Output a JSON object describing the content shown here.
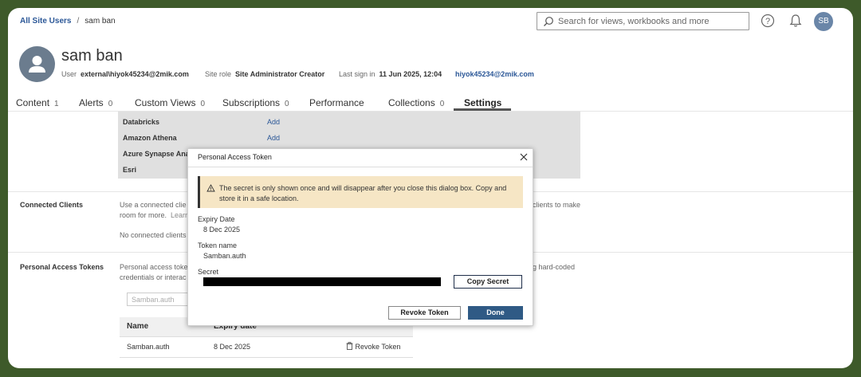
{
  "breadcrumb": {
    "parent": "All Site Users",
    "separator": "/",
    "current": "sam ban"
  },
  "search": {
    "placeholder": "Search for views, workbooks and more"
  },
  "header": {
    "avatar_initials": "SB"
  },
  "user": {
    "name": "sam ban",
    "user_label": "User",
    "user_value": "external\\hiyok45234@2mik.com",
    "role_label": "Site role",
    "role_value": "Site Administrator Creator",
    "signin_label": "Last sign in",
    "signin_value": "11 Jun 2025, 12:04",
    "email": "hiyok45234@2mik.com"
  },
  "tabs": [
    {
      "label": "Content",
      "count": "1"
    },
    {
      "label": "Alerts",
      "count": "0"
    },
    {
      "label": "Custom Views",
      "count": "0"
    },
    {
      "label": "Subscriptions",
      "count": "0"
    },
    {
      "label": "Performance",
      "count": ""
    },
    {
      "label": "Collections",
      "count": "0"
    },
    {
      "label": "Settings",
      "count": ""
    }
  ],
  "connections": {
    "rows": [
      {
        "name": "Databricks",
        "action": "Add"
      },
      {
        "name": "Amazon Athena",
        "action": "Add"
      },
      {
        "name": "Azure Synapse Ana",
        "action": ""
      },
      {
        "name": "Esri",
        "action": ""
      }
    ]
  },
  "connected_clients": {
    "label": "Connected Clients",
    "text_line1": "Use a connected clie",
    "text_line1_right": "clients to make",
    "text_line2": "room for more.",
    "text_line2_link": "Learn",
    "empty_text": "No connected clients"
  },
  "personal_access_tokens": {
    "label": "Personal Access Tokens",
    "text_line1": "Personal access toke",
    "text_line1_right": "g hard-coded",
    "text_line2": "credentials or interac",
    "filter_placeholder": "Samban.auth",
    "columns": [
      "Name",
      "Expiry date"
    ],
    "rows": [
      {
        "name": "Samban.auth",
        "expiry": "8 Dec 2025",
        "action": "Revoke Token"
      }
    ]
  },
  "dialog": {
    "title": "Personal Access Token",
    "warning": "The secret is only shown once and will disappear after you close this dialog box. Copy and store it in a safe location.",
    "expiry_label": "Expiry Date",
    "expiry_value": "8 Dec 2025",
    "token_name_label": "Token name",
    "token_name_value": "Samban.auth",
    "secret_label": "Secret",
    "copy_button": "Copy Secret",
    "revoke_button": "Revoke Token",
    "done_button": "Done"
  },
  "colors": {
    "brand_link": "#2b5797",
    "primary_button": "#2f5a85",
    "warning_bg": "#f6e6c5",
    "backdrop": "#3e5a2a"
  }
}
